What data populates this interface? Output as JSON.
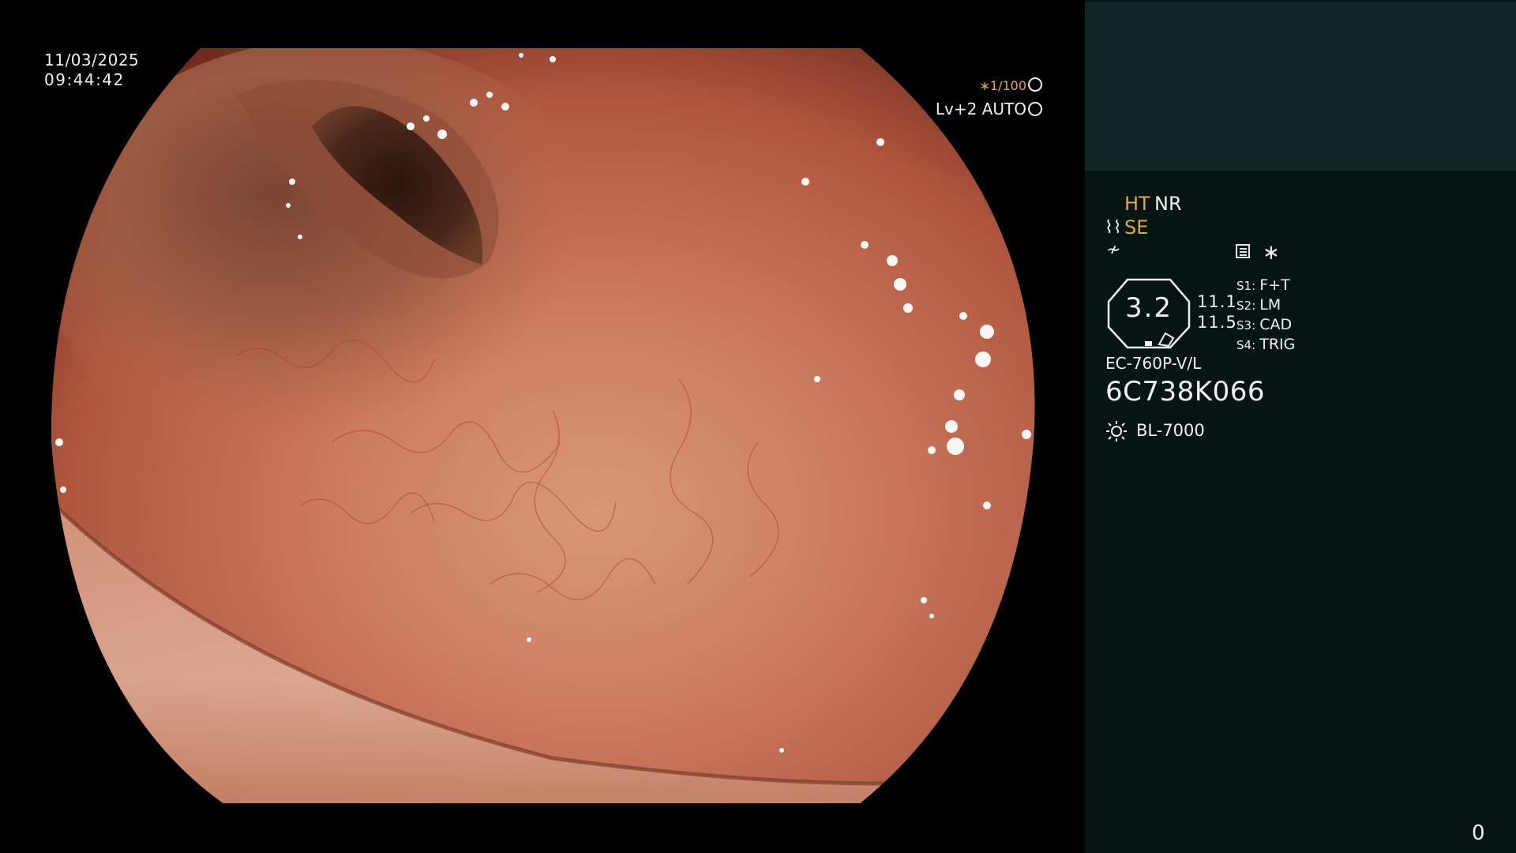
{
  "screen": {
    "date": "11/03/2025",
    "time": "09:44:42"
  },
  "image_overlay": {
    "shutter": "∗1/100",
    "level": "Lv+2 AUTO",
    "shutter_icon": "aperture-icon",
    "level_icon": "iris-icon"
  },
  "panel": {
    "ht": "HT",
    "nr": "NR",
    "se_symbol": "⌇⌇",
    "se": "SE",
    "ne_symbol": "≁",
    "star": "∗",
    "zoom": "3.2",
    "zoom_val1": "11.1",
    "zoom_val2": "11.5",
    "s1_label": "S1:",
    "s1_value": "F+T",
    "s2_label": "S2:",
    "s2_value": "LM",
    "s3_label": "S3:",
    "s3_value": "CAD",
    "s4_label": "S4:",
    "s4_value": "TRIG",
    "scope_model": "EC-760P-V/L",
    "serial": "6C738K066",
    "light_source": "BL-7000",
    "counter": "0"
  },
  "colors": {
    "panel_bg": "#061512",
    "panel_top_bg": "#0f2624",
    "amber": "#e3aa3f",
    "tissue": "#c4735a"
  },
  "icons": [
    "aperture-icon",
    "iris-icon",
    "memo-icon",
    "sun-icon",
    "octagon-zoom-icon"
  ]
}
